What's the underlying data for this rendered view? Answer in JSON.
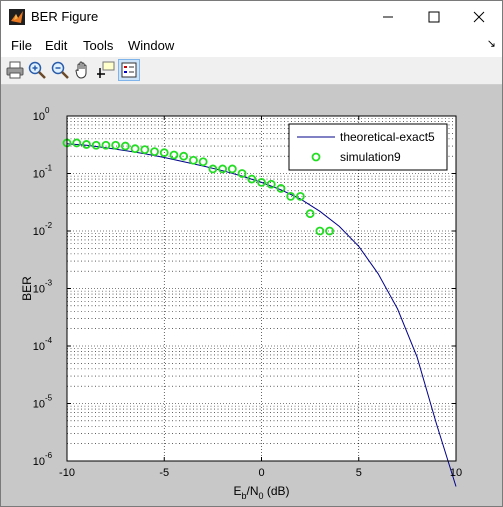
{
  "window": {
    "title": "BER Figure",
    "controls": {
      "minimize": "—",
      "maximize": "☐",
      "close": "✕"
    }
  },
  "menu": {
    "items": [
      "File",
      "Edit",
      "Tools",
      "Window"
    ],
    "dock": "↘"
  },
  "toolbar": {
    "tools": [
      {
        "icon": "print-icon"
      },
      {
        "icon": "zoom-in-icon"
      },
      {
        "icon": "zoom-out-icon"
      },
      {
        "icon": "pan-icon"
      },
      {
        "icon": "data-cursor-icon"
      },
      {
        "icon": "legend-icon",
        "active": true
      }
    ]
  },
  "chart_data": {
    "type": "line",
    "xlabel": {
      "main": "E",
      "sub1": "b",
      "mid": "/N",
      "sub2": "0",
      "tail": " (dB)"
    },
    "ylabel": "BER",
    "xlim": [
      -10,
      10
    ],
    "ylim": [
      1e-06,
      1
    ],
    "yscale": "log",
    "xticks": [
      -10,
      -5,
      0,
      5,
      10
    ],
    "xtick_labels": [
      "-10",
      "-5",
      "0",
      "5",
      "10"
    ],
    "yticks": [
      {
        "value": 1,
        "exp": "0"
      },
      {
        "value": 0.1,
        "exp": "-1"
      },
      {
        "value": 0.01,
        "exp": "-2"
      },
      {
        "value": 0.001,
        "exp": "-3"
      },
      {
        "value": 0.0001,
        "exp": "-4"
      },
      {
        "value": 1e-05,
        "exp": "-5"
      },
      {
        "value": 1e-06,
        "exp": "-6"
      }
    ],
    "grid": true,
    "legend_position": "top-right",
    "series": [
      {
        "name": "theoretical-exact5",
        "style": "line",
        "color": "#00008b",
        "x": [
          -10,
          -9,
          -8,
          -7,
          -6,
          -5,
          -4,
          -3,
          -2,
          -1,
          0,
          1,
          2,
          3,
          4,
          5,
          6,
          7,
          8,
          9,
          10
        ],
        "y": [
          0.33,
          0.31,
          0.28,
          0.25,
          0.22,
          0.19,
          0.16,
          0.135,
          0.112,
          0.09,
          0.07,
          0.052,
          0.036,
          0.022,
          0.012,
          0.0054,
          0.0018,
          0.00044,
          6.4e-05,
          4.4e-06,
          3.6e-07
        ]
      },
      {
        "name": "simulation9",
        "style": "markers",
        "color": "#22dd22",
        "x": [
          -10,
          -9.5,
          -9,
          -8.5,
          -8,
          -7.5,
          -7,
          -6.5,
          -6,
          -5.5,
          -5,
          -4.5,
          -4,
          -3.5,
          -3,
          -2.5,
          -2,
          -1.5,
          -1,
          -0.5,
          0,
          0.5,
          1,
          1.5,
          2,
          2.5,
          3,
          3.5
        ],
        "y": [
          0.34,
          0.34,
          0.32,
          0.31,
          0.31,
          0.31,
          0.3,
          0.27,
          0.26,
          0.24,
          0.23,
          0.21,
          0.2,
          0.17,
          0.16,
          0.12,
          0.12,
          0.12,
          0.1,
          0.08,
          0.07,
          0.065,
          0.055,
          0.04,
          0.04,
          0.02,
          0.01,
          0.01
        ]
      }
    ]
  }
}
